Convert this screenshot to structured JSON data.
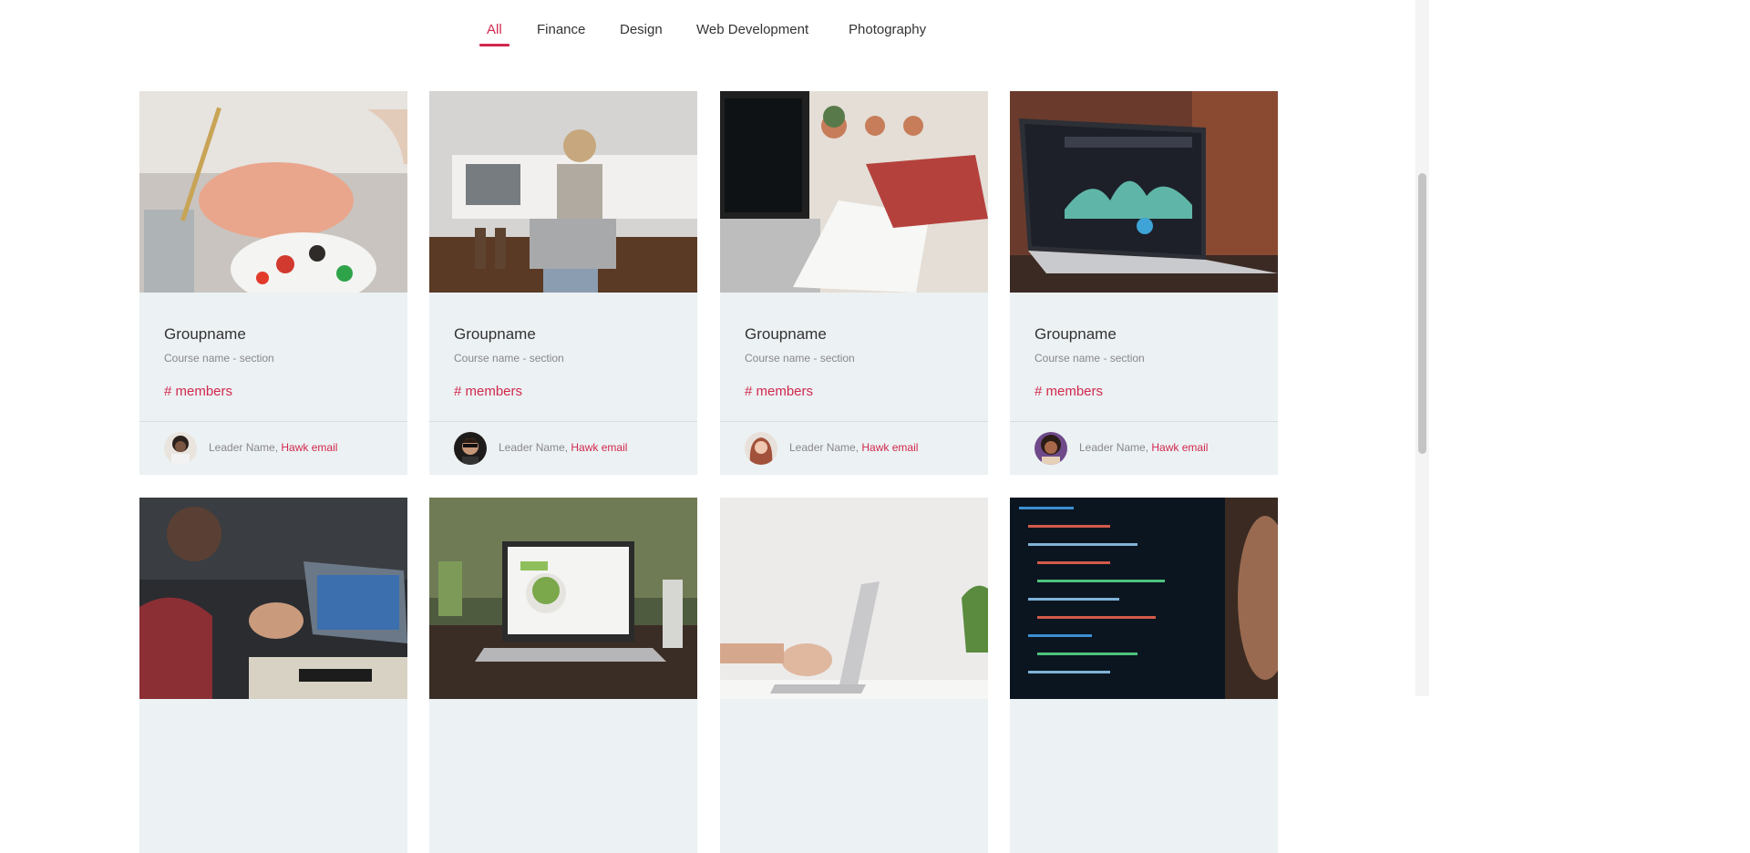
{
  "filters": {
    "tabs": [
      {
        "label": "All",
        "active": true
      },
      {
        "label": "Finance",
        "active": false
      },
      {
        "label": "Design",
        "active": false
      },
      {
        "label": "Web Development",
        "active": false
      },
      {
        "label": "Photography",
        "active": false
      }
    ]
  },
  "cards": [
    {
      "group": "Groupname",
      "course": "Course name - section",
      "members": "# members",
      "leader": "Leader Name,",
      "email": "Hawk email",
      "image": "painting-palette-photo",
      "avatar": "man-avatar"
    },
    {
      "group": "Groupname",
      "course": "Course name - section",
      "members": "# members",
      "leader": "Leader Name,",
      "email": "Hawk email",
      "image": "woman-with-laptop-photo",
      "avatar": "man-sunglasses-avatar"
    },
    {
      "group": "Groupname",
      "course": "Course name - section",
      "members": "# members",
      "leader": "Leader Name,",
      "email": "Hawk email",
      "image": "laptop-sketchbook-photo",
      "avatar": "woman-redhair-avatar"
    },
    {
      "group": "Groupname",
      "course": "Course name - section",
      "members": "# members",
      "leader": "Leader Name,",
      "email": "Hawk email",
      "image": "laptop-dashboard-photo",
      "avatar": "woman-smiling-avatar"
    },
    {
      "image": "meeting-laptop-photo"
    },
    {
      "image": "laptop-food-website-photo"
    },
    {
      "image": "hands-typing-laptop-photo"
    },
    {
      "image": "code-screen-photo"
    }
  ],
  "colors": {
    "accent": "#d1284d",
    "card_bg": "#ecf1f3"
  }
}
